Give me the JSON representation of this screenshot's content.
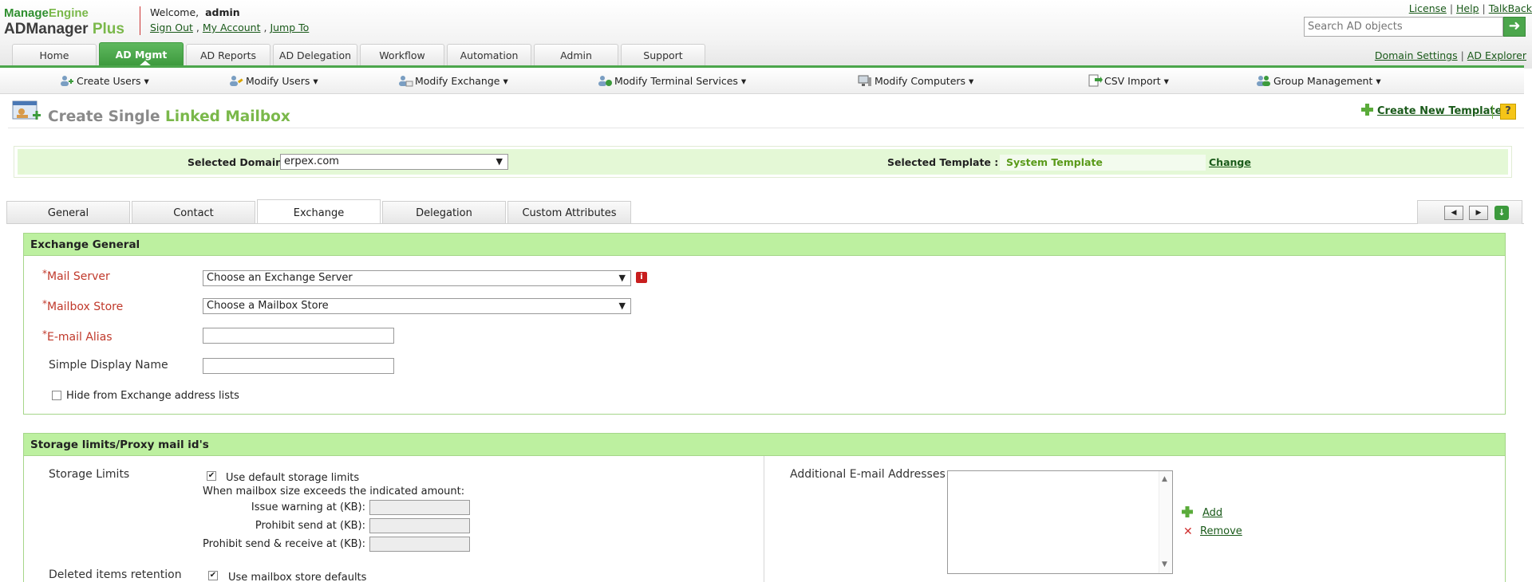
{
  "app": {
    "logo_top_m": "Manage",
    "logo_top_e": "Engine",
    "logo_main": "ADManager",
    "logo_plus": "Plus"
  },
  "header": {
    "welcome_label": "Welcome,",
    "username": "admin",
    "sign_out": "Sign Out",
    "my_account": "My Account",
    "jump_to": "Jump To",
    "sep_comma": ",",
    "license": "License",
    "help": "Help",
    "talkback": "TalkBack",
    "link_sep": "|",
    "search_placeholder": "Search AD objects",
    "search_icon": "arrow-right-icon",
    "domain_settings": "Domain Settings",
    "ad_explorer": "AD Explorer"
  },
  "main_tabs": [
    {
      "label": "Home",
      "active": false
    },
    {
      "label": "AD Mgmt",
      "active": true
    },
    {
      "label": "AD Reports",
      "active": false
    },
    {
      "label": "AD Delegation",
      "active": false
    },
    {
      "label": "Workflow",
      "active": false
    },
    {
      "label": "Automation",
      "active": false
    },
    {
      "label": "Admin",
      "active": false
    },
    {
      "label": "Support",
      "active": false
    }
  ],
  "submenu": [
    {
      "label": "Create Users ▾",
      "icon": "users-add-icon"
    },
    {
      "label": "Modify Users ▾",
      "icon": "users-edit-icon"
    },
    {
      "label": "Modify Exchange ▾",
      "icon": "exchange-icon"
    },
    {
      "label": "Modify Terminal Services ▾",
      "icon": "terminal-services-icon"
    },
    {
      "label": "Modify Computers ▾",
      "icon": "computer-icon"
    },
    {
      "label": "CSV Import ▾",
      "icon": "csv-import-icon"
    },
    {
      "label": "Group Management ▾",
      "icon": "group-icon"
    }
  ],
  "page": {
    "title_prefix": "Create Single",
    "title_highlight": "Linked Mailbox",
    "create_template": "Create New Template",
    "help_glyph": "?",
    "colors": {
      "accent": "#4ca64c",
      "header_band": "#bdf0a0",
      "domain_band": "#e4f8d6",
      "required": "#c0392b"
    }
  },
  "domain_bar": {
    "domain_label": "Selected Domain:",
    "domain_value": "erpex.com",
    "template_label": "Selected Template :",
    "template_value": "System Template",
    "change": "Change"
  },
  "sub_tabs": [
    {
      "label": "General",
      "active": false
    },
    {
      "label": "Contact",
      "active": false
    },
    {
      "label": "Exchange",
      "active": true
    },
    {
      "label": "Delegation",
      "active": false
    },
    {
      "label": "Custom Attributes",
      "active": false
    }
  ],
  "exchange_general": {
    "title": "Exchange General",
    "mail_server_label": "Mail Server",
    "mail_server_value": "Choose an Exchange Server",
    "mailbox_store_label": "Mailbox Store",
    "mailbox_store_value": "Choose a Mailbox Store",
    "email_alias_label": "E-mail Alias",
    "email_alias_value": "",
    "simple_display_label": "Simple Display Name",
    "simple_display_value": "",
    "hide_label": "Hide from Exchange address lists",
    "hide_checked": false,
    "required_star": "*",
    "info_glyph": "i"
  },
  "storage": {
    "title": "Storage limits/Proxy mail id's",
    "storage_limits_label": "Storage Limits",
    "use_default_label": "Use default storage limits",
    "use_default_checked": true,
    "exceeds_text": "When mailbox size exceeds the indicated amount:",
    "issue_warning": "Issue warning at (KB):",
    "prohibit_send": "Prohibit send at (KB):",
    "prohibit_send_receive": "Prohibit send & receive at (KB):",
    "deleted_items_label": "Deleted items retention",
    "use_store_defaults": "Use mailbox store defaults",
    "use_store_defaults_checked": true,
    "additional_email_label": "Additional E-mail Addresses",
    "add": "Add",
    "remove": "Remove"
  }
}
